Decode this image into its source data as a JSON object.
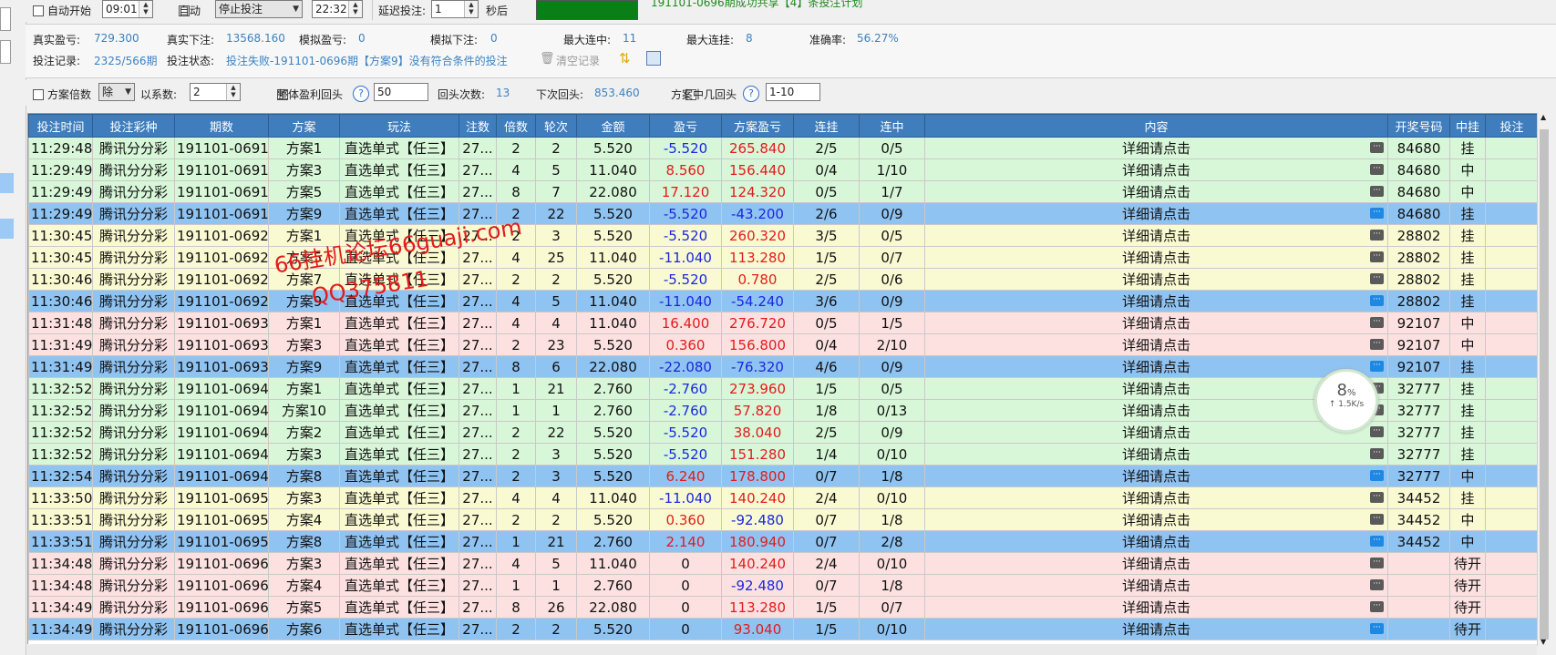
{
  "topbar": {
    "auto_start_label": "自动开始",
    "auto_start_time": "09:01",
    "auto_label": "自动",
    "auto_mode": "停止投注",
    "auto_time": "22:32",
    "delay_label": "延迟投注:",
    "delay_value": "1",
    "delay_unit": "秒后",
    "message": "191101-0696期成功共享【4】条投注计划"
  },
  "stats": {
    "real_profit_label": "真实盈亏:",
    "real_profit": "729.300",
    "real_bet_label": "真实下注:",
    "real_bet": "13568.160",
    "sim_profit_label": "模拟盈亏:",
    "sim_profit": "0",
    "sim_bet_label": "模拟下注:",
    "sim_bet": "0",
    "max_win_label": "最大连中:",
    "max_win": "11",
    "max_loss_label": "最大连挂:",
    "max_loss": "8",
    "accuracy_label": "准确率:",
    "accuracy": "56.27%",
    "record_label": "投注记录:",
    "record": "2325/566期",
    "status_label": "投注状态:",
    "status": "投注失败-191101-0696期【方案9】没有符合条件的投注",
    "clear_label": "清空记录"
  },
  "options": {
    "multiplier_label": "方案倍数",
    "op_value": "除",
    "coef_label": "以系数:",
    "coef_value": "2",
    "overall_label": "整体盈利回头",
    "overall_value": "50",
    "back_count_label": "回头次数:",
    "back_count": "13",
    "next_back_label": "下次回头:",
    "next_back": "853.460",
    "scheme_back_label": "方案中几回头",
    "scheme_back_value": "1-10"
  },
  "table": {
    "columns": [
      "投注时间",
      "投注彩种",
      "期数",
      "方案",
      "玩法",
      "注数",
      "倍数",
      "轮次",
      "金额",
      "盈亏",
      "方案盈亏",
      "连挂",
      "连中",
      "内容",
      "开奖号码",
      "中挂",
      "投注"
    ],
    "rows": [
      {
        "style": "g",
        "time": "11:29:48",
        "lottery": "腾讯分分彩",
        "period": "191101-0691",
        "scheme": "方案1",
        "play": "直选单式【任三】",
        "count": "27...",
        "mult": "2",
        "round": "2",
        "amount": "5.520",
        "pl": "-5.520",
        "pl_sign": "neg",
        "scheme_pl": "265.840",
        "scheme_pl_sign": "pos",
        "lose_streak": "2/5",
        "win_streak": "0/5",
        "content": "详细请点击",
        "draw": "84680",
        "result": "挂",
        "bet": ""
      },
      {
        "style": "g",
        "time": "11:29:49",
        "lottery": "腾讯分分彩",
        "period": "191101-0691",
        "scheme": "方案3",
        "play": "直选单式【任三】",
        "count": "27...",
        "mult": "4",
        "round": "5",
        "amount": "11.040",
        "pl": "8.560",
        "pl_sign": "pos",
        "scheme_pl": "156.440",
        "scheme_pl_sign": "pos",
        "lose_streak": "0/4",
        "win_streak": "1/10",
        "content": "详细请点击",
        "draw": "84680",
        "result": "中",
        "bet": ""
      },
      {
        "style": "g",
        "time": "11:29:49",
        "lottery": "腾讯分分彩",
        "period": "191101-0691",
        "scheme": "方案5",
        "play": "直选单式【任三】",
        "count": "27...",
        "mult": "8",
        "round": "7",
        "amount": "22.080",
        "pl": "17.120",
        "pl_sign": "pos",
        "scheme_pl": "124.320",
        "scheme_pl_sign": "pos",
        "lose_streak": "0/5",
        "win_streak": "1/7",
        "content": "详细请点击",
        "draw": "84680",
        "result": "中",
        "bet": ""
      },
      {
        "style": "b",
        "time": "11:29:49",
        "lottery": "腾讯分分彩",
        "period": "191101-0691",
        "scheme": "方案9",
        "play": "直选单式【任三】",
        "count": "27...",
        "mult": "2",
        "round": "22",
        "amount": "5.520",
        "pl": "-5.520",
        "pl_sign": "neg",
        "scheme_pl": "-43.200",
        "scheme_pl_sign": "neg",
        "lose_streak": "2/6",
        "win_streak": "0/9",
        "content": "详细请点击",
        "draw": "84680",
        "result": "挂",
        "bet": ""
      },
      {
        "style": "y",
        "time": "11:30:45",
        "lottery": "腾讯分分彩",
        "period": "191101-0692",
        "scheme": "方案1",
        "play": "直选单式【任三】",
        "count": "27...",
        "mult": "2",
        "round": "3",
        "amount": "5.520",
        "pl": "-5.520",
        "pl_sign": "neg",
        "scheme_pl": "260.320",
        "scheme_pl_sign": "pos",
        "lose_streak": "3/5",
        "win_streak": "0/5",
        "content": "详细请点击",
        "draw": "28802",
        "result": "挂",
        "bet": ""
      },
      {
        "style": "y",
        "time": "11:30:45",
        "lottery": "腾讯分分彩",
        "period": "191101-0692",
        "scheme": "方案5",
        "play": "直选单式【任三】",
        "count": "27...",
        "mult": "4",
        "round": "25",
        "amount": "11.040",
        "pl": "-11.040",
        "pl_sign": "neg",
        "scheme_pl": "113.280",
        "scheme_pl_sign": "pos",
        "lose_streak": "1/5",
        "win_streak": "0/7",
        "content": "详细请点击",
        "draw": "28802",
        "result": "挂",
        "bet": ""
      },
      {
        "style": "y",
        "time": "11:30:46",
        "lottery": "腾讯分分彩",
        "period": "191101-0692",
        "scheme": "方案7",
        "play": "直选单式【任三】",
        "count": "27...",
        "mult": "2",
        "round": "2",
        "amount": "5.520",
        "pl": "-5.520",
        "pl_sign": "neg",
        "scheme_pl": "0.780",
        "scheme_pl_sign": "pos",
        "lose_streak": "2/5",
        "win_streak": "0/6",
        "content": "详细请点击",
        "draw": "28802",
        "result": "挂",
        "bet": ""
      },
      {
        "style": "b",
        "time": "11:30:46",
        "lottery": "腾讯分分彩",
        "period": "191101-0692",
        "scheme": "方案9",
        "play": "直选单式【任三】",
        "count": "27...",
        "mult": "4",
        "round": "5",
        "amount": "11.040",
        "pl": "-11.040",
        "pl_sign": "neg",
        "scheme_pl": "-54.240",
        "scheme_pl_sign": "neg",
        "lose_streak": "3/6",
        "win_streak": "0/9",
        "content": "详细请点击",
        "draw": "28802",
        "result": "挂",
        "bet": ""
      },
      {
        "style": "p",
        "time": "11:31:48",
        "lottery": "腾讯分分彩",
        "period": "191101-0693",
        "scheme": "方案1",
        "play": "直选单式【任三】",
        "count": "27...",
        "mult": "4",
        "round": "4",
        "amount": "11.040",
        "pl": "16.400",
        "pl_sign": "pos",
        "scheme_pl": "276.720",
        "scheme_pl_sign": "pos",
        "lose_streak": "0/5",
        "win_streak": "1/5",
        "content": "详细请点击",
        "draw": "92107",
        "result": "中",
        "bet": ""
      },
      {
        "style": "p",
        "time": "11:31:49",
        "lottery": "腾讯分分彩",
        "period": "191101-0693",
        "scheme": "方案3",
        "play": "直选单式【任三】",
        "count": "27...",
        "mult": "2",
        "round": "23",
        "amount": "5.520",
        "pl": "0.360",
        "pl_sign": "pos",
        "scheme_pl": "156.800",
        "scheme_pl_sign": "pos",
        "lose_streak": "0/4",
        "win_streak": "2/10",
        "content": "详细请点击",
        "draw": "92107",
        "result": "中",
        "bet": ""
      },
      {
        "style": "b",
        "time": "11:31:49",
        "lottery": "腾讯分分彩",
        "period": "191101-0693",
        "scheme": "方案9",
        "play": "直选单式【任三】",
        "count": "27...",
        "mult": "8",
        "round": "6",
        "amount": "22.080",
        "pl": "-22.080",
        "pl_sign": "neg",
        "scheme_pl": "-76.320",
        "scheme_pl_sign": "neg",
        "lose_streak": "4/6",
        "win_streak": "0/9",
        "content": "详细请点击",
        "draw": "92107",
        "result": "挂",
        "bet": ""
      },
      {
        "style": "g",
        "time": "11:32:52",
        "lottery": "腾讯分分彩",
        "period": "191101-0694",
        "scheme": "方案1",
        "play": "直选单式【任三】",
        "count": "27...",
        "mult": "1",
        "round": "21",
        "amount": "2.760",
        "pl": "-2.760",
        "pl_sign": "neg",
        "scheme_pl": "273.960",
        "scheme_pl_sign": "pos",
        "lose_streak": "1/5",
        "win_streak": "0/5",
        "content": "详细请点击",
        "draw": "32777",
        "result": "挂",
        "bet": ""
      },
      {
        "style": "g",
        "time": "11:32:52",
        "lottery": "腾讯分分彩",
        "period": "191101-0694",
        "scheme": "方案10",
        "play": "直选单式【任三】",
        "count": "27...",
        "mult": "1",
        "round": "1",
        "amount": "2.760",
        "pl": "-2.760",
        "pl_sign": "neg",
        "scheme_pl": "57.820",
        "scheme_pl_sign": "pos",
        "lose_streak": "1/8",
        "win_streak": "0/13",
        "content": "详细请点击",
        "draw": "32777",
        "result": "挂",
        "bet": ""
      },
      {
        "style": "g",
        "time": "11:32:52",
        "lottery": "腾讯分分彩",
        "period": "191101-0694",
        "scheme": "方案2",
        "play": "直选单式【任三】",
        "count": "27...",
        "mult": "2",
        "round": "22",
        "amount": "5.520",
        "pl": "-5.520",
        "pl_sign": "neg",
        "scheme_pl": "38.040",
        "scheme_pl_sign": "pos",
        "lose_streak": "2/5",
        "win_streak": "0/9",
        "content": "详细请点击",
        "draw": "32777",
        "result": "挂",
        "bet": ""
      },
      {
        "style": "g",
        "time": "11:32:52",
        "lottery": "腾讯分分彩",
        "period": "191101-0694",
        "scheme": "方案3",
        "play": "直选单式【任三】",
        "count": "27...",
        "mult": "2",
        "round": "3",
        "amount": "5.520",
        "pl": "-5.520",
        "pl_sign": "neg",
        "scheme_pl": "151.280",
        "scheme_pl_sign": "pos",
        "lose_streak": "1/4",
        "win_streak": "0/10",
        "content": "详细请点击",
        "draw": "32777",
        "result": "挂",
        "bet": ""
      },
      {
        "style": "b",
        "time": "11:32:54",
        "lottery": "腾讯分分彩",
        "period": "191101-0694",
        "scheme": "方案8",
        "play": "直选单式【任三】",
        "count": "27...",
        "mult": "2",
        "round": "3",
        "amount": "5.520",
        "pl": "6.240",
        "pl_sign": "pos",
        "scheme_pl": "178.800",
        "scheme_pl_sign": "pos",
        "lose_streak": "0/7",
        "win_streak": "1/8",
        "content": "详细请点击",
        "draw": "32777",
        "result": "中",
        "bet": ""
      },
      {
        "style": "y",
        "time": "11:33:50",
        "lottery": "腾讯分分彩",
        "period": "191101-0695",
        "scheme": "方案3",
        "play": "直选单式【任三】",
        "count": "27...",
        "mult": "4",
        "round": "4",
        "amount": "11.040",
        "pl": "-11.040",
        "pl_sign": "neg",
        "scheme_pl": "140.240",
        "scheme_pl_sign": "pos",
        "lose_streak": "2/4",
        "win_streak": "0/10",
        "content": "详细请点击",
        "draw": "34452",
        "result": "挂",
        "bet": ""
      },
      {
        "style": "y",
        "time": "11:33:51",
        "lottery": "腾讯分分彩",
        "period": "191101-0695",
        "scheme": "方案4",
        "play": "直选单式【任三】",
        "count": "27...",
        "mult": "2",
        "round": "2",
        "amount": "5.520",
        "pl": "0.360",
        "pl_sign": "pos",
        "scheme_pl": "-92.480",
        "scheme_pl_sign": "neg",
        "lose_streak": "0/7",
        "win_streak": "1/8",
        "content": "详细请点击",
        "draw": "34452",
        "result": "中",
        "bet": ""
      },
      {
        "style": "b",
        "time": "11:33:51",
        "lottery": "腾讯分分彩",
        "period": "191101-0695",
        "scheme": "方案8",
        "play": "直选单式【任三】",
        "count": "27...",
        "mult": "1",
        "round": "21",
        "amount": "2.760",
        "pl": "2.140",
        "pl_sign": "pos",
        "scheme_pl": "180.940",
        "scheme_pl_sign": "pos",
        "lose_streak": "0/7",
        "win_streak": "2/8",
        "content": "详细请点击",
        "draw": "34452",
        "result": "中",
        "bet": ""
      },
      {
        "style": "p",
        "time": "11:34:48",
        "lottery": "腾讯分分彩",
        "period": "191101-0696",
        "scheme": "方案3",
        "play": "直选单式【任三】",
        "count": "27...",
        "mult": "4",
        "round": "5",
        "amount": "11.040",
        "pl": "0",
        "pl_sign": "",
        "scheme_pl": "140.240",
        "scheme_pl_sign": "pos",
        "lose_streak": "2/4",
        "win_streak": "0/10",
        "content": "详细请点击",
        "draw": "",
        "result": "待开",
        "bet": ""
      },
      {
        "style": "p",
        "time": "11:34:48",
        "lottery": "腾讯分分彩",
        "period": "191101-0696",
        "scheme": "方案4",
        "play": "直选单式【任三】",
        "count": "27...",
        "mult": "1",
        "round": "1",
        "amount": "2.760",
        "pl": "0",
        "pl_sign": "",
        "scheme_pl": "-92.480",
        "scheme_pl_sign": "neg",
        "lose_streak": "0/7",
        "win_streak": "1/8",
        "content": "详细请点击",
        "draw": "",
        "result": "待开",
        "bet": ""
      },
      {
        "style": "p",
        "time": "11:34:49",
        "lottery": "腾讯分分彩",
        "period": "191101-0696",
        "scheme": "方案5",
        "play": "直选单式【任三】",
        "count": "27...",
        "mult": "8",
        "round": "26",
        "amount": "22.080",
        "pl": "0",
        "pl_sign": "",
        "scheme_pl": "113.280",
        "scheme_pl_sign": "pos",
        "lose_streak": "1/5",
        "win_streak": "0/7",
        "content": "详细请点击",
        "draw": "",
        "result": "待开",
        "bet": ""
      },
      {
        "style": "b",
        "time": "11:34:49",
        "lottery": "腾讯分分彩",
        "period": "191101-0696",
        "scheme": "方案6",
        "play": "直选单式【任三】",
        "count": "27...",
        "mult": "2",
        "round": "2",
        "amount": "5.520",
        "pl": "0",
        "pl_sign": "",
        "scheme_pl": "93.040",
        "scheme_pl_sign": "pos",
        "lose_streak": "1/5",
        "win_streak": "0/10",
        "content": "详细请点击",
        "draw": "",
        "result": "待开",
        "bet": ""
      }
    ]
  },
  "watermark": {
    "line1": "66挂机论坛66guaji.com",
    "line2": "QQ375811"
  },
  "netmon": {
    "percent": "8",
    "percent_unit": "%",
    "speed": "↑ 1.5K/s"
  }
}
